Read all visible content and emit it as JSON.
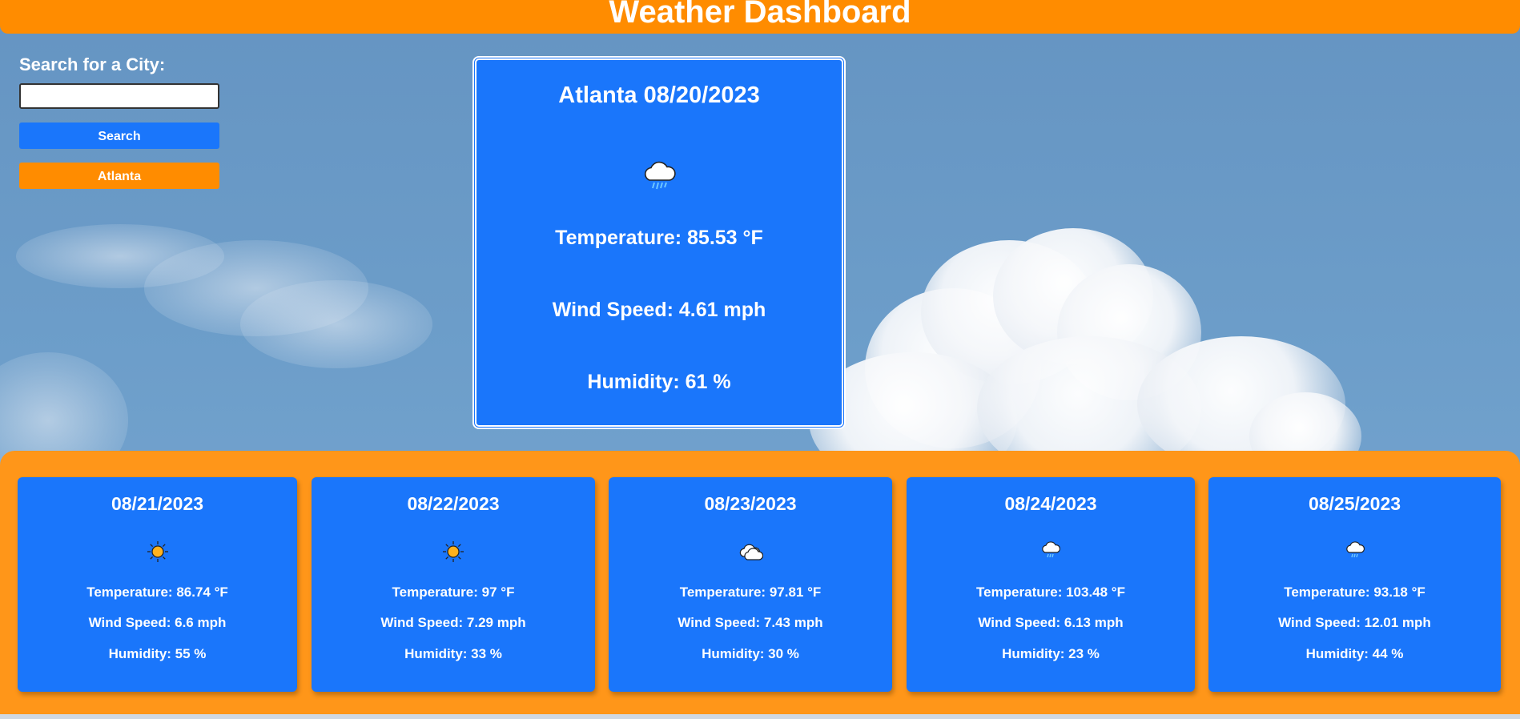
{
  "header": {
    "title": "Weather Dashboard"
  },
  "search": {
    "label": "Search for a City:",
    "input_value": "",
    "search_button": "Search",
    "history": [
      "Atlanta"
    ]
  },
  "current": {
    "title": "Atlanta 08/20/2023",
    "icon": "rain-cloud-icon",
    "temperature": "Temperature: 85.53 °F",
    "wind": "Wind Speed: 4.61 mph",
    "humidity": "Humidity: 61 %"
  },
  "forecast": [
    {
      "date": "08/21/2023",
      "icon": "sun-icon",
      "temperature": "Temperature: 86.74 °F",
      "wind": "Wind Speed: 6.6 mph",
      "humidity": "Humidity: 55 %"
    },
    {
      "date": "08/22/2023",
      "icon": "sun-icon",
      "temperature": "Temperature: 97 °F",
      "wind": "Wind Speed: 7.29 mph",
      "humidity": "Humidity: 33 %"
    },
    {
      "date": "08/23/2023",
      "icon": "clouds-icon",
      "temperature": "Temperature: 97.81 °F",
      "wind": "Wind Speed: 7.43 mph",
      "humidity": "Humidity: 30 %"
    },
    {
      "date": "08/24/2023",
      "icon": "rain-cloud-icon",
      "temperature": "Temperature: 103.48 °F",
      "wind": "Wind Speed: 6.13 mph",
      "humidity": "Humidity: 23 %"
    },
    {
      "date": "08/25/2023",
      "icon": "rain-cloud-icon",
      "temperature": "Temperature: 93.18 °F",
      "wind": "Wind Speed: 12.01 mph",
      "humidity": "Humidity: 44 %"
    }
  ],
  "colors": {
    "header": "#ff8c00",
    "card": "#1a76fb",
    "forecast_bg": "#ff9619",
    "history_button": "#ff8c00"
  }
}
